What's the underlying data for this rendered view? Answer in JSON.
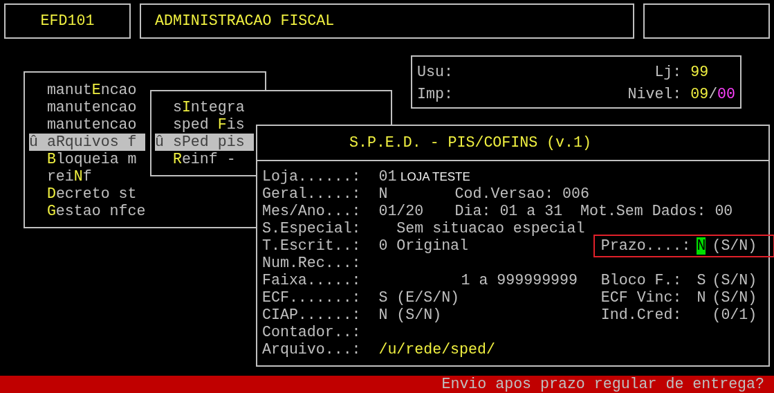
{
  "header": {
    "program": "EFD101",
    "title": "ADMINISTRACAO FISCAL"
  },
  "info": {
    "rows": [
      {
        "label": "Usu:",
        "right_label": "Lj:",
        "value": [
          {
            "text": "99",
            "kind": "primary"
          }
        ]
      },
      {
        "label": "Imp:",
        "right_label": "Nivel:",
        "value": [
          {
            "text": "09",
            "kind": "primary"
          },
          {
            "text": "/",
            "kind": "plain"
          },
          {
            "text": "00",
            "kind": "secondary"
          }
        ]
      }
    ]
  },
  "menus": [
    {
      "items": [
        {
          "before": "manut",
          "hotkey": "E",
          "after": "ncao",
          "selected": false
        },
        {
          "before": "manutencao",
          "selected": false
        },
        {
          "before": "manutencao",
          "selected": false
        },
        {
          "marker": "û",
          "before": "a",
          "hotkey": "R",
          "after": "quivos f",
          "selected": true
        },
        {
          "hotkey": "B",
          "after": "loqueia m",
          "selected": false
        },
        {
          "before": "rei",
          "hotkey": "N",
          "after": "f",
          "selected": false
        },
        {
          "hotkey": "D",
          "after": "ecreto st",
          "selected": false
        },
        {
          "hotkey": "G",
          "after": "estao nfce",
          "selected": false
        }
      ]
    },
    {
      "items": [
        {
          "before": "s",
          "hotkey": "I",
          "after": "ntegra",
          "selected": false
        },
        {
          "before": "sped ",
          "hotkey": "F",
          "after": "is",
          "selected": false
        },
        {
          "marker": "û",
          "before": "s",
          "hotkey": "P",
          "after": "ed pis",
          "selected": true
        },
        {
          "hotkey": "R",
          "after": "einf -",
          "selected": false
        }
      ]
    }
  ],
  "dialog": {
    "title": "S.P.E.D. - PIS/COFINS (v.1)",
    "rows": [
      {
        "label": "Loja......:",
        "value": "01",
        "note": "LOJA TESTE"
      },
      {
        "label": "Geral.....:",
        "value": "N",
        "mid": "Cod.Versao: 006"
      },
      {
        "label": "Mes/Ano...:",
        "value": "01/20",
        "mid": "Dia: 01 a 31",
        "far": "Mot.Sem Dados: 00"
      },
      {
        "label": "S.Especial:",
        "description": "Sem situacao especial"
      },
      {
        "label": "T.Escrit..:",
        "value": "0 Original",
        "side": {
          "label": "Prazo....:",
          "value": "N",
          "hint": "(S/N)",
          "focused": true
        }
      },
      {
        "label": "Num.Rec...:"
      },
      {
        "label": "Faixa.....:",
        "range": "1 a 999999999",
        "side": {
          "label": "Bloco F.:",
          "value": "S",
          "hint": "(S/N)",
          "focused": false
        }
      },
      {
        "label": "ECF.......:",
        "value": "S (E/S/N)",
        "side": {
          "label": "ECF Vinc:",
          "value": "N",
          "hint": "(S/N)",
          "focused": false
        }
      },
      {
        "label": "CIAP......:",
        "value": "N (S/N)",
        "side": {
          "label": "Ind.Cred:",
          "hint": "(0/1)",
          "focused": false
        }
      },
      {
        "label": "Contador..:"
      },
      {
        "label": "Arquivo...:",
        "path": "/u/rede/sped/"
      }
    ]
  },
  "status_bar": {
    "message": "Envio apos prazo regular de entrega?"
  }
}
